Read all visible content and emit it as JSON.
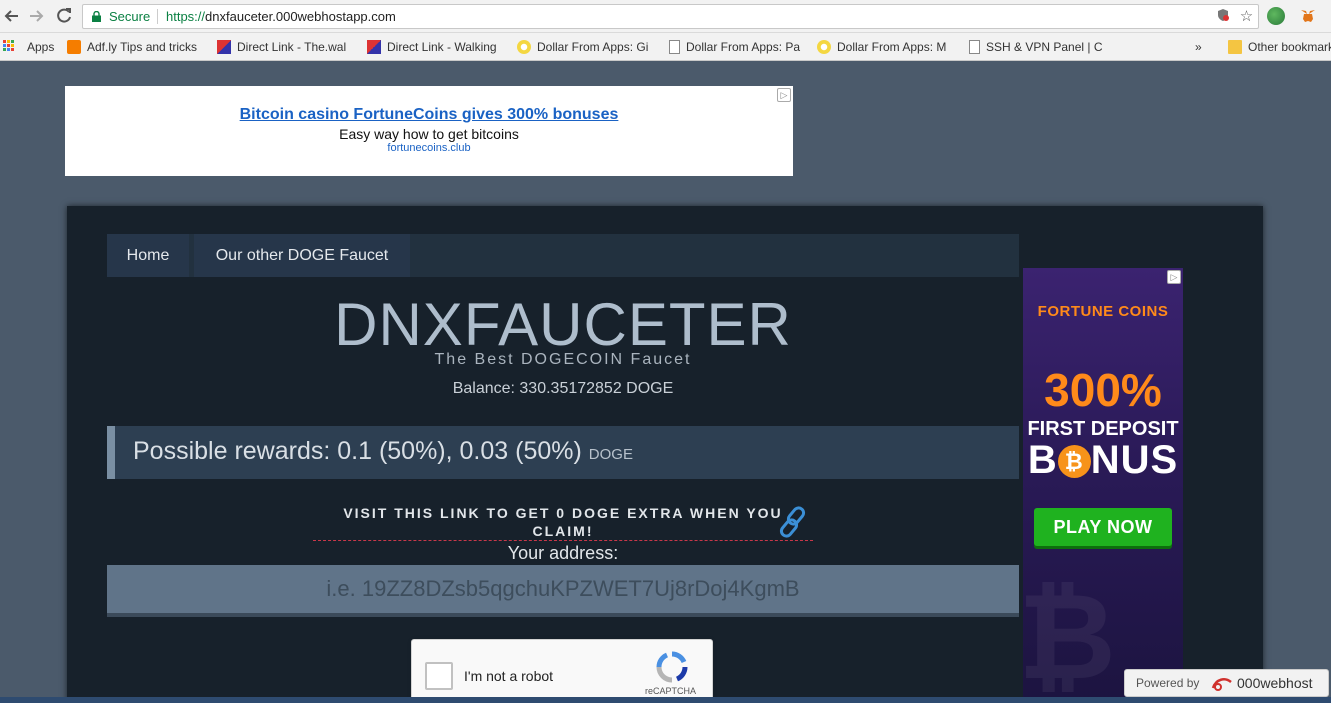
{
  "browser": {
    "secure_label": "Secure",
    "url_scheme": "https://",
    "url_host": "dnxfauceter.000webhostapp.com",
    "bookmarks": [
      {
        "label": "Apps"
      },
      {
        "label": "Adf.ly Tips and tricks"
      },
      {
        "label": "Direct Link - The.wal"
      },
      {
        "label": "Direct Link - Walking"
      },
      {
        "label": "Dollar From Apps: Gi"
      },
      {
        "label": "Dollar From Apps: Pa"
      },
      {
        "label": "Dollar From Apps: M"
      },
      {
        "label": "SSH & VPN Panel | C"
      }
    ],
    "overflow_label": "»",
    "other_bookmarks": "Other bookmarks"
  },
  "ad_top": {
    "headline": "Bitcoin casino FortuneCoins gives 300% bonuses",
    "description": "Easy way how to get bitcoins",
    "display_url": "fortunecoins.club"
  },
  "nav": {
    "items": [
      {
        "label": "Home"
      },
      {
        "label": "Our other DOGE Faucet"
      }
    ]
  },
  "site": {
    "title": "DNXFAUCETER",
    "subtitle": "The Best DOGECOIN Faucet",
    "balance": "Balance: 330.35172852 DOGE"
  },
  "rewards": {
    "text": "Possible rewards: 0.1 (50%), 0.03 (50%)",
    "unit": "DOGE"
  },
  "visit_link": {
    "text": "VISIT THIS LINK TO GET 0 DOGE EXTRA WHEN YOU CLAIM!"
  },
  "address": {
    "label": "Your address:",
    "placeholder": "i.e. 19ZZ8DZsb5qgchuKPZWET7Uj8rDoj4KgmB",
    "value": ""
  },
  "recaptcha": {
    "label": "I'm not a robot",
    "brand": "reCAPTCHA",
    "checked": false
  },
  "ad_side": {
    "logo": "FORTUNE COINS",
    "percent": "300%",
    "line1": "FIRST DEPOSIT",
    "bonus_pre": "B",
    "bonus_post": "NUS",
    "cta": "PLAY NOW"
  },
  "powered_by": {
    "label": "Powered by",
    "brand": "000webhost"
  },
  "colors": {
    "page_bg": "#4b5a6b",
    "panel_bg": "#17212b",
    "accent_orange": "#ff8a1a",
    "play_green": "#1fb21f"
  }
}
